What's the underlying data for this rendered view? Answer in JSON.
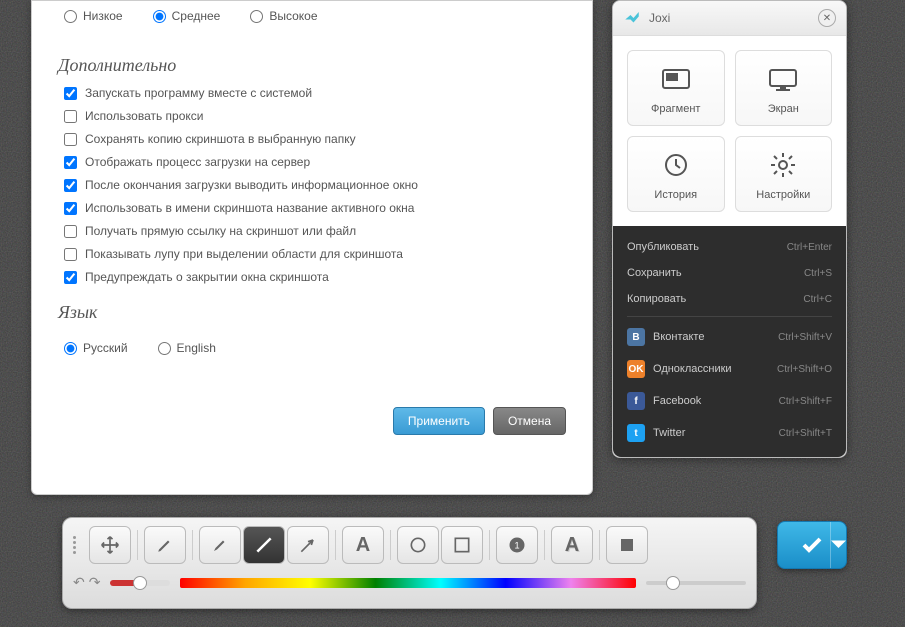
{
  "quality": {
    "low": "Низкое",
    "medium": "Среднее",
    "high": "Высокое",
    "selected": "medium"
  },
  "sections": {
    "additional": "Дополнительно",
    "language": "Язык"
  },
  "checks": [
    {
      "label": "Запускать программу вместе с системой",
      "checked": true
    },
    {
      "label": "Использовать прокси",
      "checked": false
    },
    {
      "label": "Сохранять копию скриншота в выбранную папку",
      "checked": false
    },
    {
      "label": "Отображать процесс загрузки на сервер",
      "checked": true
    },
    {
      "label": "После окончания загрузки выводить информационное окно",
      "checked": true
    },
    {
      "label": "Использовать в имени скриншота название активного окна",
      "checked": true
    },
    {
      "label": "Получать прямую ссылку на скриншот или файл",
      "checked": false
    },
    {
      "label": "Показывать лупу при выделении области для скриншота",
      "checked": false
    },
    {
      "label": "Предупреждать о закрытии окна скриншота",
      "checked": true
    }
  ],
  "languages": {
    "ru": "Русский",
    "en": "English",
    "selected": "ru"
  },
  "buttons": {
    "apply": "Применить",
    "cancel": "Отмена"
  },
  "joxi": {
    "title": "Joxi",
    "tiles": [
      {
        "label": "Фрагмент",
        "icon": "fragment"
      },
      {
        "label": "Экран",
        "icon": "screen"
      },
      {
        "label": "История",
        "icon": "history"
      },
      {
        "label": "Настройки",
        "icon": "settings"
      }
    ],
    "actions": [
      {
        "label": "Опубликовать",
        "shortcut": "Ctrl+Enter"
      },
      {
        "label": "Сохранить",
        "shortcut": "Ctrl+S"
      },
      {
        "label": "Копировать",
        "shortcut": "Ctrl+C"
      }
    ],
    "social": [
      {
        "label": "Вконтакте",
        "shortcut": "Ctrl+Shift+V",
        "bg": "#4c75a3",
        "ch": "В"
      },
      {
        "label": "Одноклассники",
        "shortcut": "Ctrl+Shift+O",
        "bg": "#ed812b",
        "ch": "OK"
      },
      {
        "label": "Facebook",
        "shortcut": "Ctrl+Shift+F",
        "bg": "#3b5998",
        "ch": "f"
      },
      {
        "label": "Twitter",
        "shortcut": "Ctrl+Shift+T",
        "bg": "#1da1f2",
        "ch": "t"
      }
    ]
  },
  "toolbar": {
    "tools": [
      "move",
      "pencil",
      "marker",
      "line",
      "arrow",
      "text",
      "circle",
      "rect",
      "blur",
      "text-bg",
      "rect-fill"
    ],
    "active": "line"
  }
}
